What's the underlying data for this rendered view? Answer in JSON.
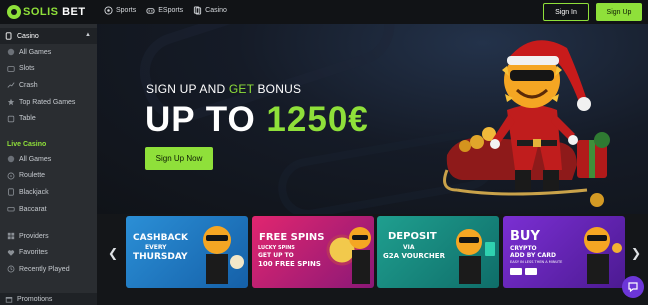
{
  "brand": {
    "name_part1": "SOLIS",
    "name_part2": "BET"
  },
  "nav": [
    {
      "label": "Sports",
      "icon": "soccer-ball-icon"
    },
    {
      "label": "ESports",
      "icon": "gamepad-icon"
    },
    {
      "label": "Casino",
      "icon": "cards-icon"
    }
  ],
  "auth": {
    "signin_label": "Sign In",
    "signup_label": "Sign Up"
  },
  "sidebar": {
    "casino_header": "Casino",
    "casino_items": [
      {
        "label": "All Games",
        "icon": "all-games-icon"
      },
      {
        "label": "Slots",
        "icon": "slots-icon"
      },
      {
        "label": "Crash",
        "icon": "crash-icon"
      },
      {
        "label": "Top Rated Games",
        "icon": "top-rated-icon"
      },
      {
        "label": "Table",
        "icon": "table-icon"
      }
    ],
    "live_header": "Live Casino",
    "live_items": [
      {
        "label": "All Games",
        "icon": "all-games-icon"
      },
      {
        "label": "Roulette",
        "icon": "roulette-icon"
      },
      {
        "label": "Blackjack",
        "icon": "blackjack-icon"
      },
      {
        "label": "Baccarat",
        "icon": "baccarat-icon"
      }
    ],
    "extra_items": [
      {
        "label": "Providers",
        "icon": "providers-icon"
      },
      {
        "label": "Favorites",
        "icon": "heart-icon"
      },
      {
        "label": "Recently Played",
        "icon": "clock-icon"
      }
    ],
    "promotions_label": "Promotions"
  },
  "hero": {
    "subtitle_part1": "SIGN UP AND ",
    "subtitle_highlight": "GET",
    "subtitle_part2": " BONUS",
    "title_part1": "UP TO ",
    "title_amount": "1250€",
    "cta_label": "Sign Up Now"
  },
  "promos": [
    {
      "line1": "CASHBACK",
      "line2": "EVERY",
      "line3": "THURSDAY"
    },
    {
      "line1": "FREE SPINS",
      "line2": "LUCKY SPINS",
      "line3": "GET UP TO",
      "line4": "100 FREE SPINS"
    },
    {
      "line1": "DEPOSIT",
      "line2": "VIA",
      "line3": "G2A VOURCHER"
    },
    {
      "line1": "BUY",
      "line2": "CRYPTO",
      "line3": "ADD BY CARD",
      "line4": "EASY IN LESS THEN A MINUTE"
    }
  ],
  "colors": {
    "accent": "#8fe03a",
    "sidebar": "#2a2d31",
    "topbar": "#111316"
  }
}
